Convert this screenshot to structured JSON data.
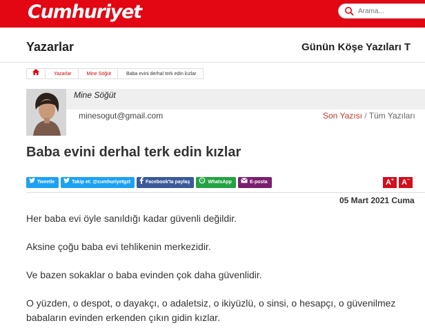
{
  "header": {
    "logo": "Cumhuriyet",
    "search_placeholder": "Arama...",
    "brand_color": "#e30613"
  },
  "nav": {
    "section_title": "Yazarlar",
    "right_title": "Günün Köşe Yazıları T"
  },
  "breadcrumb": {
    "items": [
      "Yazarlar",
      "Mine Söğüt",
      "Baba evini derhal terk edin kızlar"
    ]
  },
  "author": {
    "name": "Mine Söğüt",
    "email": "minesogut@gmail.com",
    "last_post": "Son Yazısı",
    "separator": "/",
    "all_posts": "Tüm Yazıları"
  },
  "article": {
    "title": "Baba evini derhal terk edin kızlar",
    "date": "05 Mart 2021 Cuma",
    "paragraphs": [
      "Her baba evi öyle sanıldığı kadar güvenli değildir.",
      "Aksine çoğu baba evi tehlikenin merkezidir.",
      "Ve bazen sokaklar o baba evinden çok daha güvenlidir.",
      "O yüzden, o despot, o dayakçı, o adaletsiz, o ikiyüzlü, o sinsi, o hesapçı, o güvenilmez babaların evinden erkenden çıkın gidin kızlar."
    ]
  },
  "share": {
    "tweet": "Tweetle",
    "follow": "Takip et: @cumhuriyetgzt",
    "facebook": "Facebook'ta paylaş",
    "whatsapp": "WhatsApp",
    "email": "E-posta"
  },
  "font_controls": {
    "increase": "A",
    "increase_sign": "+",
    "decrease": "A",
    "decrease_sign": "−"
  }
}
